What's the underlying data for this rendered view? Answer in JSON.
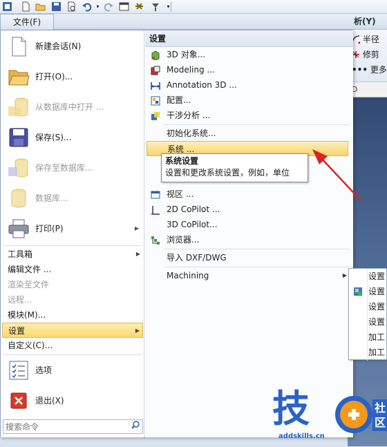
{
  "quick_access": {
    "icons": [
      "app-icon",
      "new-icon",
      "open-icon",
      "save-icon",
      "print-preview-icon",
      "undo-icon",
      "undo-dropdown-icon",
      "redo-icon",
      "window-icon",
      "tools-icon",
      "customize-icon",
      "qat-dropdown-icon"
    ]
  },
  "ribbon": {
    "file_tab": "文件(F)",
    "right_tab": "析(Y)",
    "right_buttons": [
      "半径",
      "修剪",
      "更多"
    ],
    "ruler_label": "D"
  },
  "left_menu": {
    "big_items": [
      {
        "label": "新建会话(N)",
        "disabled": false,
        "icon": "new-session-icon"
      },
      {
        "label": "打开(O)...",
        "disabled": false,
        "icon": "folder-open-icon"
      },
      {
        "label": "从数据库中打开 ...",
        "disabled": true,
        "icon": "database-open-icon"
      },
      {
        "label": "保存(S)...",
        "disabled": false,
        "icon": "save-icon"
      },
      {
        "label": "保存至数据库...",
        "disabled": true,
        "icon": "database-save-icon"
      },
      {
        "label": "数据库...",
        "disabled": true,
        "icon": "database-icon"
      },
      {
        "label": "打印(P)",
        "disabled": false,
        "icon": "printer-icon"
      }
    ],
    "small_items": [
      {
        "label": "工具箱",
        "disabled": false,
        "has_submenu": true
      },
      {
        "label": "编辑文件 ...",
        "disabled": false,
        "has_submenu": false
      },
      {
        "label": "渲染至文件",
        "disabled": true,
        "has_submenu": false
      },
      {
        "label": "远程...",
        "disabled": true,
        "has_submenu": false
      },
      {
        "label": "模块(M)...",
        "disabled": false,
        "has_submenu": false
      },
      {
        "label": "设置",
        "disabled": false,
        "has_submenu": true,
        "selected": true
      },
      {
        "label": "自定义(C)...",
        "disabled": false,
        "has_submenu": false
      }
    ],
    "bottom_items": [
      {
        "label": "选项",
        "icon": "options-icon"
      },
      {
        "label": "退出(X)",
        "icon": "exit-icon"
      }
    ],
    "search_placeholder": "搜索命令"
  },
  "settings_menu": {
    "header": "设置",
    "items": [
      {
        "label": "3D 对象...",
        "icon": "3d-object-icon"
      },
      {
        "label": "Modeling ...",
        "icon": "modeling-icon"
      },
      {
        "label": "Annotation 3D ...",
        "icon": "annotation-3d-icon"
      },
      {
        "label": "配置...",
        "icon": "configuration-icon"
      },
      {
        "label": "干涉分析 ...",
        "icon": "interference-icon"
      },
      {
        "label": "初始化系统...",
        "icon": ""
      },
      {
        "label": "系统 ...",
        "icon": "",
        "selected": true
      },
      {
        "label": "视区 ...",
        "icon": "viewport-icon"
      },
      {
        "label": "2D CoPilot ...",
        "icon": "copilot-2d-icon"
      },
      {
        "label": "3D CoPilot...",
        "icon": ""
      },
      {
        "label": "浏览器...",
        "icon": "browser-icon"
      },
      {
        "label": "导入 DXF/DWG",
        "icon": ""
      },
      {
        "label": "Machining",
        "icon": "",
        "has_submenu": true
      }
    ]
  },
  "tooltip": {
    "title": "系统设置",
    "body": "设置和更改系统设置，例如，单位"
  },
  "flyout": {
    "items": [
      "设置",
      "设置",
      "设置",
      "设置",
      "加工",
      "加工"
    ]
  },
  "watermark": {
    "text": "技",
    "badge": "社区",
    "url": "addskills.cn"
  },
  "colors": {
    "selection_top": "#fdeeb3",
    "selection_bottom": "#fbd86e",
    "annotation_arrow": "#e02020",
    "watermark_blue": "#2a62c8",
    "watermark_orange": "#f39a1d"
  }
}
